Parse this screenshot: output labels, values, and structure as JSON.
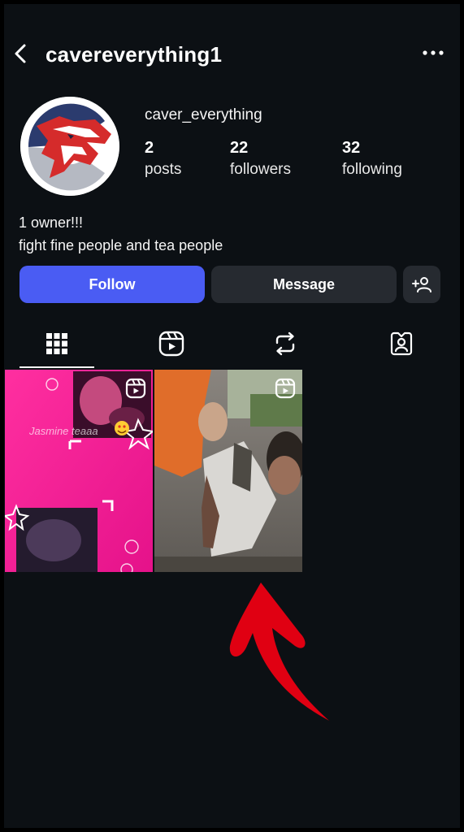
{
  "header": {
    "username": "cavereverything1",
    "back_icon": "chevron-left-icon",
    "more_icon": "more-horizontal-icon"
  },
  "profile": {
    "display_name": "caver_everything",
    "stats": [
      {
        "value": "2",
        "label": "posts"
      },
      {
        "value": "22",
        "label": "followers"
      },
      {
        "value": "32",
        "label": "following"
      }
    ],
    "bio": [
      "1 owner!!!",
      "fight fine people and tea people"
    ]
  },
  "actions": {
    "follow_label": "Follow",
    "message_label": "Message",
    "add_icon": "add-person-icon"
  },
  "tabs": [
    {
      "icon": "grid-icon",
      "active": true
    },
    {
      "icon": "reels-icon",
      "active": false
    },
    {
      "icon": "reposts-icon",
      "active": false
    },
    {
      "icon": "tagged-icon",
      "active": false
    }
  ],
  "posts": [
    {
      "type": "reel",
      "overlay_text": "Jasmine teaaa"
    },
    {
      "type": "reel"
    }
  ],
  "colors": {
    "background": "#0c1014",
    "follow_button": "#4a5cf3",
    "secondary_button": "#262a30",
    "annotation_arrow": "#e00012"
  }
}
